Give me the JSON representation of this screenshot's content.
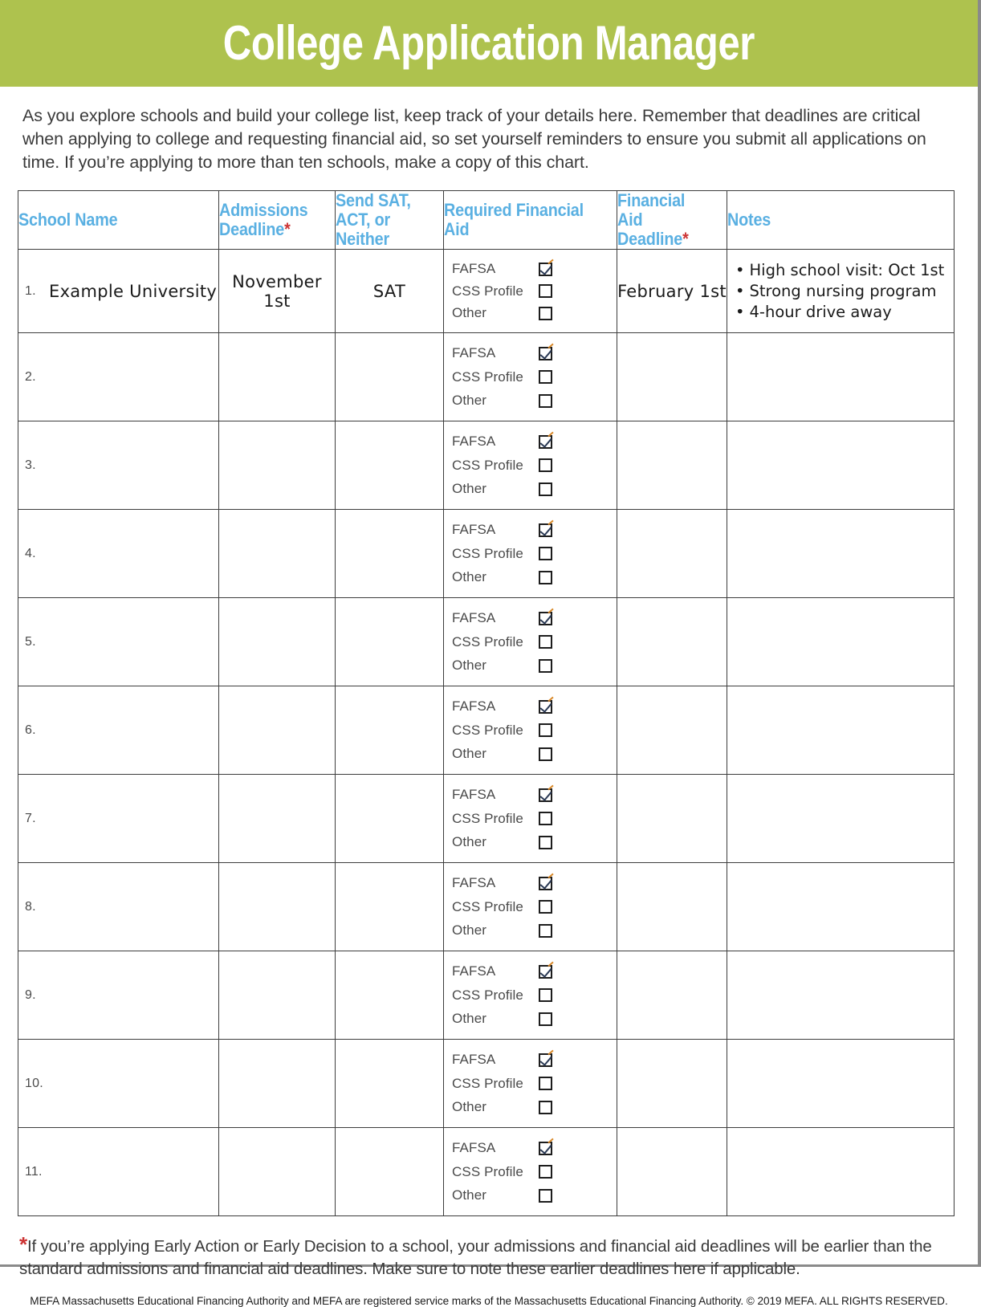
{
  "banner": {
    "title": "College Application Manager",
    "background_color": "#aec24e",
    "text_color": "#ffffff"
  },
  "intro": {
    "text": "As you explore schools and build your college list, keep track of your details here. Remember that deadlines are critical when applying to college and requesting financial aid, so set yourself reminders to ensure you submit all applications on time. If you’re applying to more than ten schools, make a copy of this chart."
  },
  "colors": {
    "header_blue": "#5ab0e2",
    "asterisk_red": "#cc3333",
    "grid_line": "#3d3d3d"
  },
  "table": {
    "headers": [
      {
        "label": "School Name",
        "asterisk": false
      },
      {
        "label": "Admissions Deadline",
        "asterisk": true
      },
      {
        "label": "Send SAT, ACT, or Neither",
        "asterisk": false
      },
      {
        "label": "Required Financial Aid",
        "asterisk": false
      },
      {
        "label": "Financial Aid Deadline",
        "asterisk": true
      },
      {
        "label": "Notes",
        "asterisk": false
      }
    ],
    "financial_aid_options": [
      "FAFSA",
      "CSS Profile",
      "Other"
    ],
    "rows": [
      {
        "number": "1.",
        "school_name": "Example University",
        "admissions_deadline": "November 1st",
        "send_scores": "SAT",
        "financial_aid_checked": [
          true,
          false,
          false
        ],
        "financial_aid_deadline": "February 1st",
        "notes": [
          "High school visit: Oct 1st",
          "Strong nursing program",
          "4-hour drive away"
        ]
      },
      {
        "number": "2.",
        "school_name": "",
        "admissions_deadline": "",
        "send_scores": "",
        "financial_aid_checked": [
          true,
          false,
          false
        ],
        "financial_aid_deadline": "",
        "notes": []
      },
      {
        "number": "3.",
        "school_name": "",
        "admissions_deadline": "",
        "send_scores": "",
        "financial_aid_checked": [
          true,
          false,
          false
        ],
        "financial_aid_deadline": "",
        "notes": []
      },
      {
        "number": "4.",
        "school_name": "",
        "admissions_deadline": "",
        "send_scores": "",
        "financial_aid_checked": [
          true,
          false,
          false
        ],
        "financial_aid_deadline": "",
        "notes": []
      },
      {
        "number": "5.",
        "school_name": "",
        "admissions_deadline": "",
        "send_scores": "",
        "financial_aid_checked": [
          true,
          false,
          false
        ],
        "financial_aid_deadline": "",
        "notes": []
      },
      {
        "number": "6.",
        "school_name": "",
        "admissions_deadline": "",
        "send_scores": "",
        "financial_aid_checked": [
          true,
          false,
          false
        ],
        "financial_aid_deadline": "",
        "notes": []
      },
      {
        "number": "7.",
        "school_name": "",
        "admissions_deadline": "",
        "send_scores": "",
        "financial_aid_checked": [
          true,
          false,
          false
        ],
        "financial_aid_deadline": "",
        "notes": []
      },
      {
        "number": "8.",
        "school_name": "",
        "admissions_deadline": "",
        "send_scores": "",
        "financial_aid_checked": [
          true,
          false,
          false
        ],
        "financial_aid_deadline": "",
        "notes": []
      },
      {
        "number": "9.",
        "school_name": "",
        "admissions_deadline": "",
        "send_scores": "",
        "financial_aid_checked": [
          true,
          false,
          false
        ],
        "financial_aid_deadline": "",
        "notes": []
      },
      {
        "number": "10.",
        "school_name": "",
        "admissions_deadline": "",
        "send_scores": "",
        "financial_aid_checked": [
          true,
          false,
          false
        ],
        "financial_aid_deadline": "",
        "notes": []
      },
      {
        "number": "11.",
        "school_name": "",
        "admissions_deadline": "",
        "send_scores": "",
        "financial_aid_checked": [
          true,
          false,
          false
        ],
        "financial_aid_deadline": "",
        "notes": []
      }
    ]
  },
  "footnote": {
    "marker": "*",
    "text": "If you’re applying Early Action or Early Decision to a school, your admissions and financial aid deadlines will be earlier than the standard admissions and financial aid deadlines. Make sure to note these earlier deadlines here if applicable."
  },
  "copyright": {
    "text": "MEFA Massachusetts Educational Financing Authority and MEFA are registered service marks of the Massachusetts Educational Financing Authority. © 2019 MEFA. ALL RIGHTS RESERVED."
  }
}
